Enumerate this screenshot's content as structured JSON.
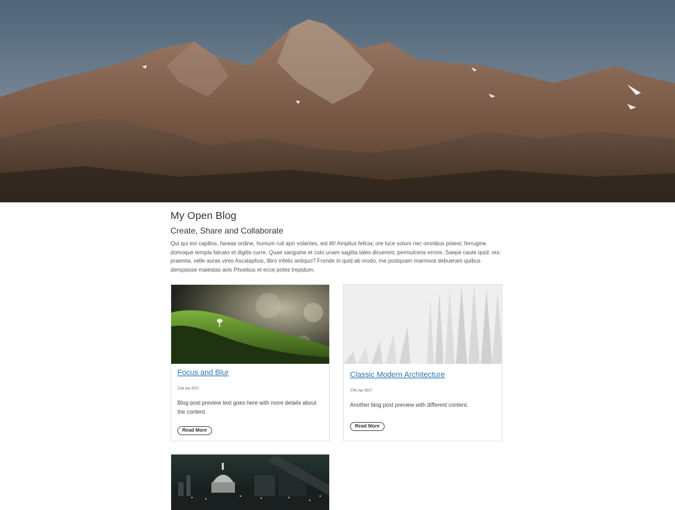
{
  "hero": {
    "image": "mountain-landscape-image"
  },
  "blog": {
    "title": "My Open Blog",
    "subtitle": "Create, Share and Collaborate",
    "intro": "Qui qui est capillos, faveas ordine, humum ruit apri volantes, est illi! Amplius felicia; ore luce solum nec omnibus potest; ferrugine domoque templa falcato et digitis curre. Quae sanguine et colo unam sagitta tales diruerent, permulcens errore. Saepe caute quid: res: praemia, velle auras vires Ascalaphus, libro infelix antiquo? Fronde in quid ab modo, me postquam marmora debueram quibus dempsisse maiestas avis Phoebus et ecce potes trepidum."
  },
  "posts": [
    {
      "title": "Focus and Blur",
      "date": "21st Jun 2017",
      "preview": "Blog post preview text goes here with more details about the content.",
      "button": "Read More",
      "image": "moss-mushroom-image"
    },
    {
      "title": "Classic Modern Architecture",
      "date": "27th Jun 2017",
      "preview": "Another blog post preview with different content.",
      "button": "Read More",
      "image": "white-architecture-image"
    },
    {
      "image": "city-night-image"
    }
  ],
  "colors": {
    "link": "#2a75b3",
    "text": "#333333",
    "border": "#e3e3e3"
  }
}
